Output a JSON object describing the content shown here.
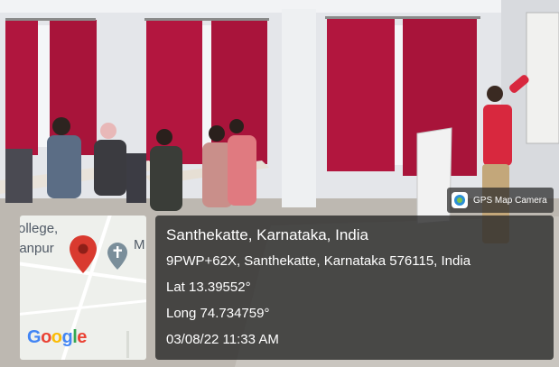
{
  "badge": {
    "label": "GPS Map Camera",
    "icon": "gps-map-camera-icon"
  },
  "geotag": {
    "place": "Santhekatte, Karnataka, India",
    "address": "9PWP+62X, Santhekatte, Karnataka 576115, India",
    "latitude": "Lat 13.39552°",
    "longitude": "Long 74.734759°",
    "datetime": "03/08/22 11:33 AM"
  },
  "map": {
    "text_1": "ollege,",
    "text_2": "janpur",
    "text_3": "M",
    "pin_icon": "location-pin-icon",
    "church_icon": "church-marker-icon",
    "brand": "Google"
  },
  "colors": {
    "panel_bg": "#282828",
    "pin_red": "#d93a2f",
    "curtain_red": "#b0163e",
    "wall": "#e6e8ec",
    "floor": "#b9b4ad"
  }
}
